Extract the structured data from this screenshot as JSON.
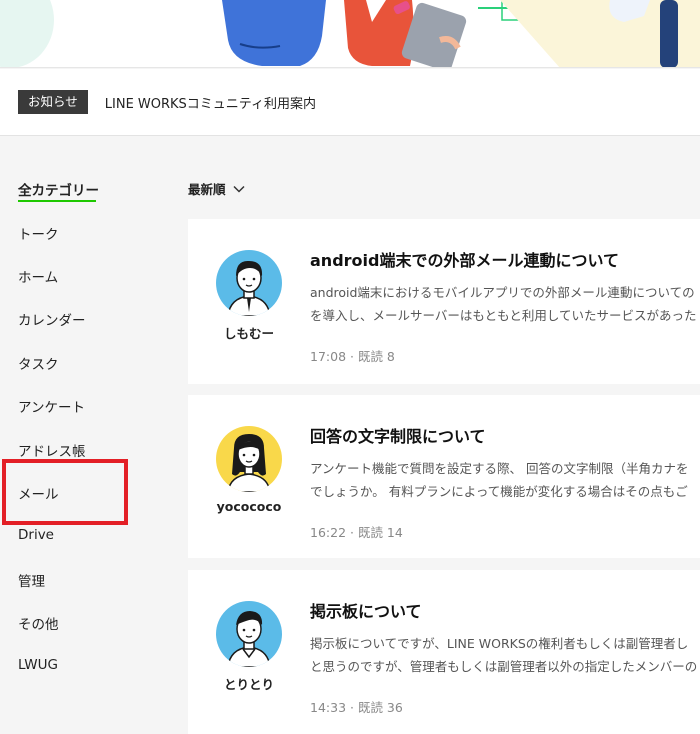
{
  "notice": {
    "badge": "お知らせ",
    "text": "LINE WORKSコミュニティ利用案内"
  },
  "sidebar": {
    "items": [
      {
        "label": "全カテゴリー",
        "active": true
      },
      {
        "label": "トーク"
      },
      {
        "label": "ホーム"
      },
      {
        "label": "カレンダー"
      },
      {
        "label": "タスク"
      },
      {
        "label": "アンケート"
      },
      {
        "label": "アドレス帳"
      },
      {
        "label": "メール",
        "highlighted": true
      },
      {
        "label": "Drive"
      },
      {
        "label": "管理"
      },
      {
        "label": "その他"
      },
      {
        "label": "LWUG"
      }
    ]
  },
  "sort": {
    "label": "最新順",
    "icon": "chevron-down-icon"
  },
  "posts": [
    {
      "author": "しもむー",
      "title": "android端末での外部メール連動について",
      "excerpt": [
        "android端末におけるモバイルアプリでの外部メール連動についての",
        "を導入し、メールサーバーはもともと利用していたサービスがあった"
      ],
      "meta": "17:08 · 既読 8",
      "avatar_bg": "#5bbbe8"
    },
    {
      "author": "yocococo",
      "title": "回答の文字制限について",
      "excerpt": [
        "アンケート機能で質問を設定する際、 回答の文字制限（半角カナを",
        "でしょうか。 有料プランによって機能が変化する場合はその点もご"
      ],
      "meta": "16:22 · 既読 14",
      "avatar_bg": "#f9d84a"
    },
    {
      "author": "とりとり",
      "title": "掲示板について",
      "excerpt": [
        "掲示板についてですが、LINE WORKSの権利者もしくは副管理者し",
        "と思うのですが、管理者もしくは副管理者以外の指定したメンバーの"
      ],
      "meta": "14:33 · 既読 36",
      "avatar_bg": "#5bbbe8"
    }
  ],
  "colors": {
    "accent_green": "#1ec800",
    "highlight_red": "#e31f26",
    "badge_bg": "#3a3a3a"
  }
}
